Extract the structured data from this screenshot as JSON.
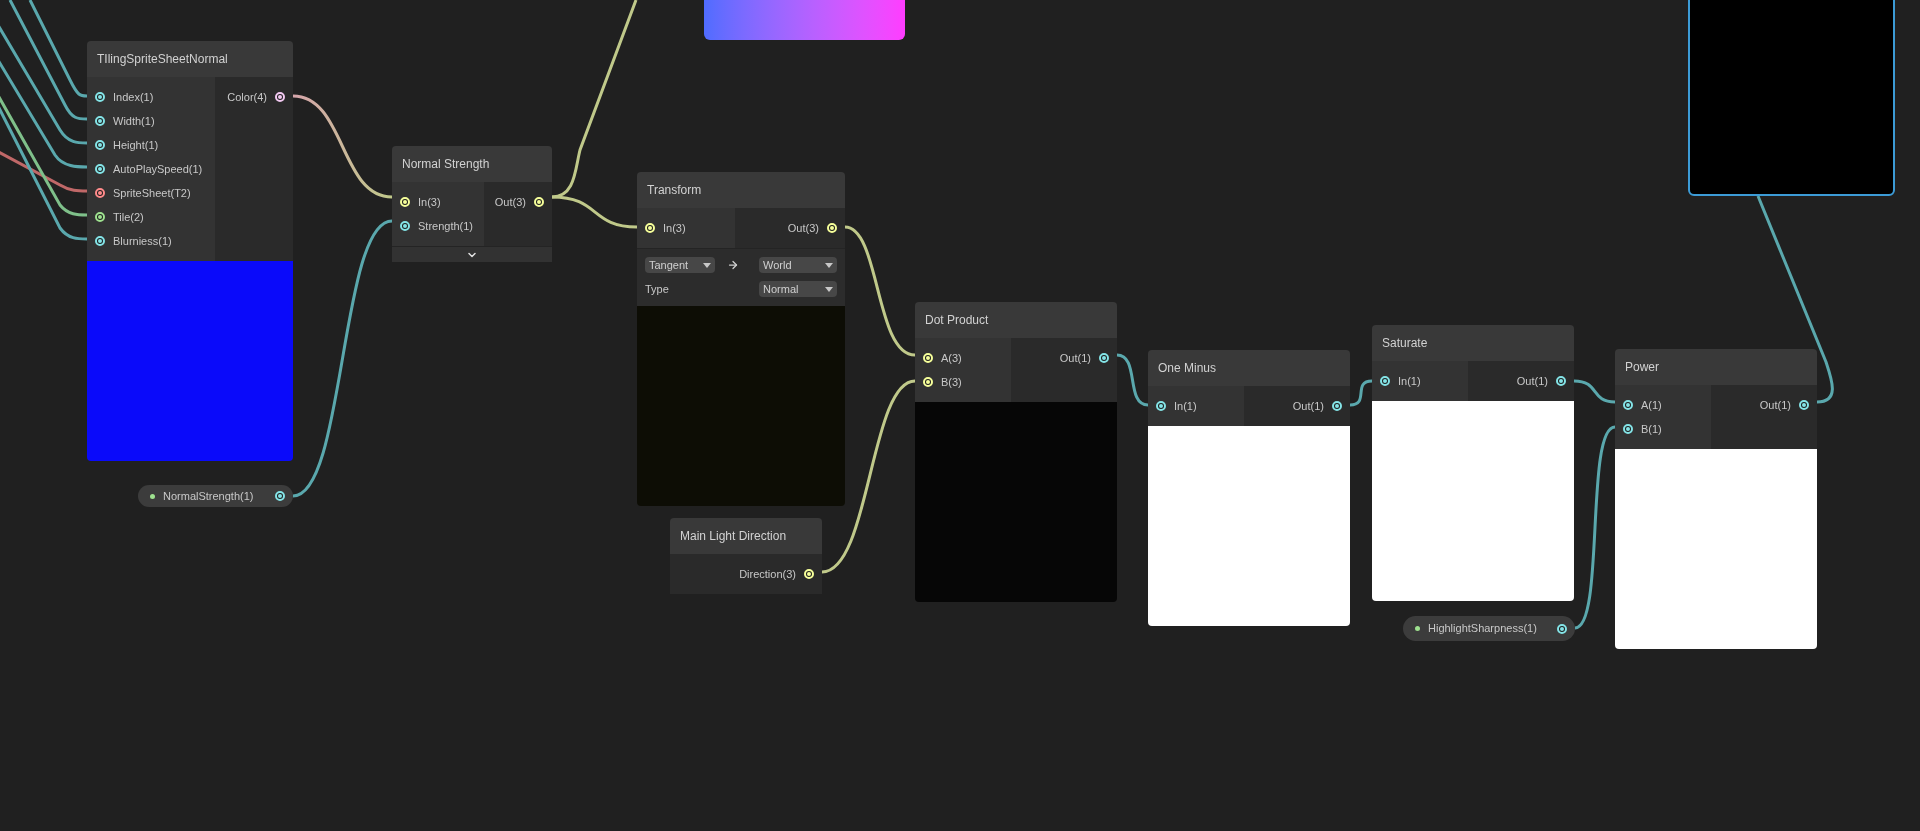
{
  "nodes": [
    {
      "title": "TIlingSpriteSheetNormal",
      "inputs": [
        {
          "label": "Index(1)",
          "color": "#84e4e7"
        },
        {
          "label": "Width(1)",
          "color": "#84e4e7"
        },
        {
          "label": "Height(1)",
          "color": "#84e4e7"
        },
        {
          "label": "AutoPlaySpeed(1)",
          "color": "#84e4e7"
        },
        {
          "label": "SpriteSheet(T2)",
          "color": "#ff8b8b"
        },
        {
          "label": "Tile(2)",
          "color": "#9ee18f"
        },
        {
          "label": "Blurniess(1)",
          "color": "#84e4e7"
        }
      ],
      "outputs": [
        {
          "label": "Color(4)",
          "color": "#f1c8f0"
        }
      ],
      "preview": {
        "kind": "normal_map"
      }
    },
    {
      "title": "Normal Strength",
      "inputs": [
        {
          "label": "In(3)",
          "color": "#f6ff9a"
        },
        {
          "label": "Strength(1)",
          "color": "#84e4e7"
        }
      ],
      "outputs": [
        {
          "label": "Out(3)",
          "color": "#f6ff9a"
        }
      ],
      "expand_toggle": true
    },
    {
      "title": "Transform",
      "inputs": [
        {
          "label": "In(3)",
          "color": "#f6ff9a"
        }
      ],
      "outputs": [
        {
          "label": "Out(3)",
          "color": "#f6ff9a"
        }
      ],
      "controls": {
        "from": "Tangent",
        "to": "World",
        "type_label": "Type",
        "type_value": "Normal"
      },
      "preview": {
        "kind": "tangent_colors"
      }
    },
    {
      "title": "Main Light Direction",
      "outputs": [
        {
          "label": "Direction(3)",
          "color": "#f6ff9a"
        }
      ]
    },
    {
      "title": "Dot Product",
      "inputs": [
        {
          "label": "A(3)",
          "color": "#f6ff9a"
        },
        {
          "label": "B(3)",
          "color": "#f6ff9a"
        }
      ],
      "outputs": [
        {
          "label": "Out(1)",
          "color": "#84e4e7"
        }
      ],
      "preview": {
        "kind": "dark"
      }
    },
    {
      "title": "One Minus",
      "inputs": [
        {
          "label": "In(1)",
          "color": "#84e4e7"
        }
      ],
      "outputs": [
        {
          "label": "Out(1)",
          "color": "#84e4e7"
        }
      ],
      "preview": {
        "kind": "white"
      }
    },
    {
      "title": "Saturate",
      "inputs": [
        {
          "label": "In(1)",
          "color": "#84e4e7"
        }
      ],
      "outputs": [
        {
          "label": "Out(1)",
          "color": "#84e4e7"
        }
      ],
      "preview": {
        "kind": "white"
      }
    },
    {
      "title": "Power",
      "inputs": [
        {
          "label": "A(1)",
          "color": "#84e4e7"
        },
        {
          "label": "B(1)",
          "color": "#84e4e7"
        }
      ],
      "outputs": [
        {
          "label": "Out(1)",
          "color": "#84e4e7"
        }
      ],
      "preview": {
        "kind": "white"
      }
    }
  ],
  "properties": [
    {
      "label": "NormalStrength(1)",
      "color": "#84e4e7"
    },
    {
      "label": "HighlightSharpness(1)",
      "color": "#84e4e7"
    }
  ],
  "partial_previews": [
    {
      "kind": "gradient",
      "selected": false
    },
    {
      "kind": "black",
      "selected": true
    }
  ]
}
